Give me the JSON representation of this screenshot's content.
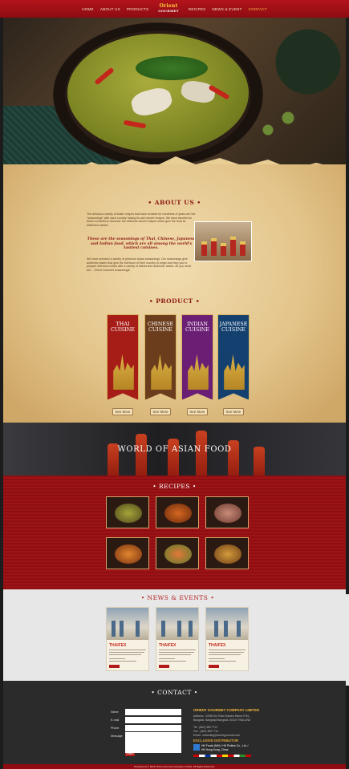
{
  "nav": {
    "items": [
      "HOME",
      "ABOUT US",
      "PRODUCTS",
      "RECIPES",
      "NEWS & EVENT",
      "CONTACT"
    ],
    "logo_top": "Orient",
    "logo_bottom": "GOURMET"
  },
  "about": {
    "heading": "• ABOUT US •",
    "p1": "The delicious variety of Asian recipes that have evolved for hundreds of years are the \"seasonings\" with each country having its own secret recipes. We have traveled to these countries to discover the delicious secret recipes which give the food its distinctive tastes.",
    "quote": "These are the seasonings of Thai, Chinese, Japanese and Indian food, which are all among the world's tastiest cuisines.",
    "p2": "We have selected a variety of premium Asian seasonings. Our seasonings give authentic tastes that give the full flavor of their country of origin and help you to prepare delicious meals with a variety of dishes and authentic tastes. All you need are... Orient Gourmet seasonings!"
  },
  "product": {
    "heading": "• PRODUCT •",
    "cuisines": [
      {
        "name": "THAI CUISINE",
        "color": "#a61d17",
        "see_more": "See More"
      },
      {
        "name": "CHINESE CUISINE",
        "color": "#6b3d1c",
        "see_more": "See More"
      },
      {
        "name": "INDIAN CUISINE",
        "color": "#6a1e74",
        "see_more": "See More"
      },
      {
        "name": "JAPANESE CUISINE",
        "color": "#13406f",
        "see_more": "See More"
      }
    ]
  },
  "world": {
    "title": "WORLD OF ASIAN FOOD"
  },
  "recipes": {
    "heading": "• RECIPES •",
    "items": [
      "green-curry",
      "red-curry",
      "sliced-beef",
      "seafood-curry",
      "vegetables",
      "massaman-curry"
    ]
  },
  "news": {
    "heading": "• NEWS & EVENTS •",
    "cards": [
      {
        "title": "THAIFEX"
      },
      {
        "title": "THAIFEX"
      },
      {
        "title": "THAIFEX"
      }
    ]
  },
  "contact": {
    "heading": "• CONTACT •",
    "labels": {
      "name": "Name",
      "email": "E-mail",
      "phone": "Phone",
      "message": "Message"
    },
    "submit": "SUBMIT",
    "company": "ORIENT GOURMET COMPANY LIMITED",
    "address": "Address : 22/88 Soi Thian Kaluew Rama 9 Rd., Bangkok, Bangkapi Bangkok 10310 THAILAND",
    "tel": "Tel : (662) 369 7712",
    "fax": "Fax : (662) 369 7711",
    "email": "Email : marketing@orientgourmet.com",
    "exclusive": "EXCLUSIVE DISTRIBUTOR",
    "distributor": "HK Foods (MH) / HK Pickles Co., Ltd. / HK Hong Kong, China"
  },
  "footer": {
    "text": "Powered by  © 2015 Orient Gourmet Company Limited. All Rights Reserved."
  }
}
